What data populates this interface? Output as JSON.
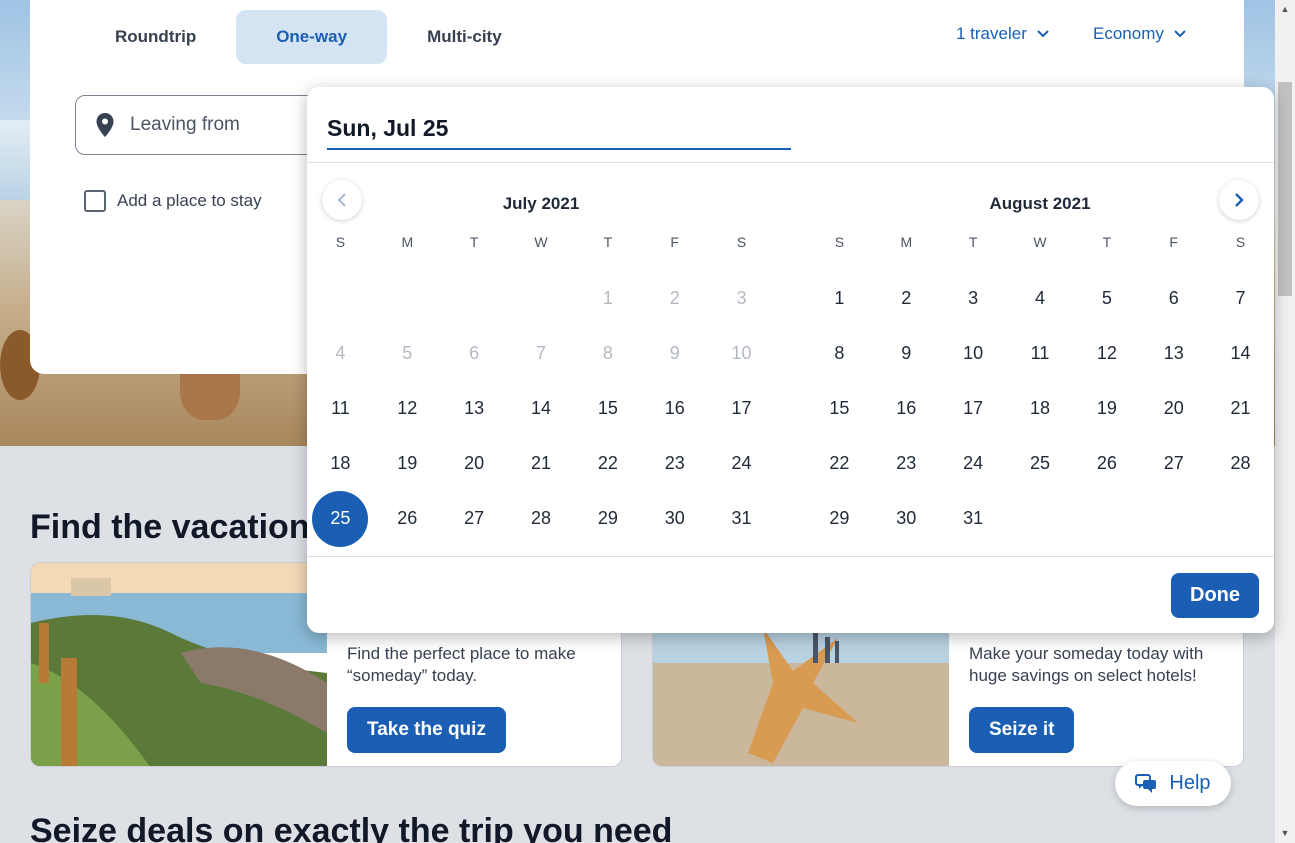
{
  "trip_types": [
    {
      "label": "Roundtrip",
      "active": false
    },
    {
      "label": "One-way",
      "active": true
    },
    {
      "label": "Multi-city",
      "active": false
    }
  ],
  "travelers": {
    "label": "1 traveler"
  },
  "cabin_class": {
    "label": "Economy"
  },
  "leaving_from": {
    "placeholder": "Leaving from"
  },
  "add_stay": {
    "label": "Add a place to stay",
    "checked": false
  },
  "date_picker": {
    "input_value": "Sun, Jul 25",
    "weekdays": [
      "S",
      "M",
      "T",
      "W",
      "T",
      "F",
      "S"
    ],
    "months": [
      {
        "title": "July 2021",
        "first_weekday": 4,
        "days": 31,
        "past_through": 10,
        "selected": 25
      },
      {
        "title": "August 2021",
        "first_weekday": 0,
        "days": 31,
        "past_through": 0,
        "selected": null
      }
    ],
    "done_label": "Done"
  },
  "vacation_heading": "Find the vacation",
  "promos": [
    {
      "description": "Find the perfect place to make “someday” today.",
      "button": "Take the quiz"
    },
    {
      "description": "Make your someday today with huge savings on select hotels!",
      "button": "Seize it"
    }
  ],
  "deals_heading": "Seize deals on exactly the trip you need",
  "help": {
    "label": "Help"
  },
  "colors": {
    "brand": "#1a5fb4",
    "selected_tab_bg": "#d4e4f2"
  }
}
